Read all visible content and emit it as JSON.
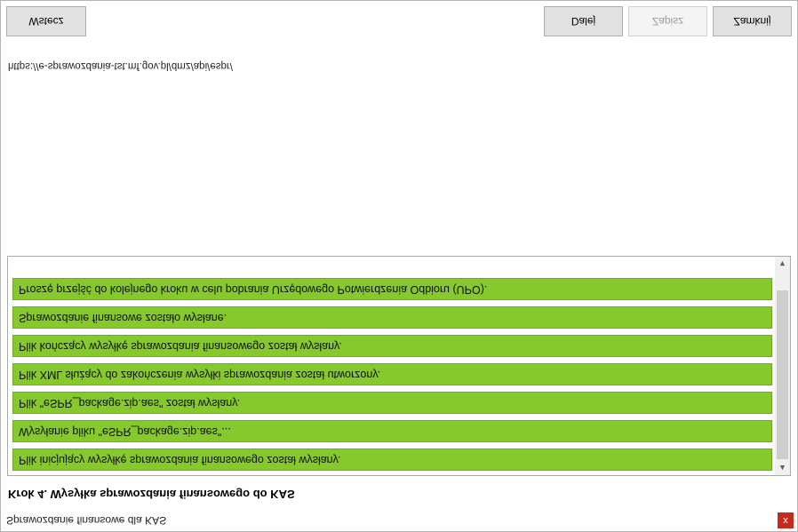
{
  "window": {
    "title": "Sprawozdanie finansowe dla KAS",
    "close_glyph": "x"
  },
  "heading": "Krok 4. Wysyłka sprawozdania finansowego do KAS",
  "log": {
    "items": [
      "Plik inicjujący wysyłkę sprawozdania finansowego został wysłany.",
      "Wysyłanie pliku \"eSPR_package.zip.aes\"...",
      "Plik \"eSPR_package.zip.aes\" został wysłany.",
      "Plik XML służący do zakończenia wysyłki sprawozdania został utworzony.",
      "Plik kończący wysyłkę sprawozdania finansowego został wysłany.",
      "Sprawozdanie finansowe zostało wysłane.",
      "Proszę przejść do kolejnego kroku w celu pobrania Urzędowego Potwierdzenia Odbioru (UPO)."
    ]
  },
  "url": "https://e-sprawozdania-tst.mf.gov.pl/dmz/api/espr/",
  "buttons": {
    "back": "Wstecz",
    "next": "Dalej",
    "save": "Zapisz",
    "close": "Zamknij"
  },
  "colors": {
    "log_item_bg": "#85c92c",
    "close_bg": "#c42b1c"
  }
}
